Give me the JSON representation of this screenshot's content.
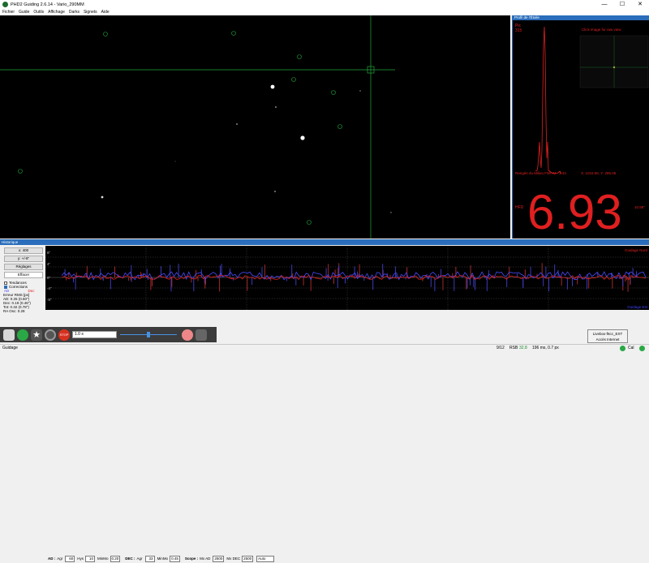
{
  "window": {
    "title": "PHD2 Guiding 2.6.14 - Vario_290MM",
    "minimize": "—",
    "maximize": "☐",
    "close": "✕"
  },
  "menu": [
    "Fichier",
    "Guide",
    "Outils",
    "Affichage",
    "Darks",
    "Signets",
    "Aide"
  ],
  "profile_panel": {
    "title": "Profil de l'Étoile",
    "pic_label": "Pic",
    "pic_value": "315",
    "click_hint": "Click image for raw view",
    "fwhm_text": "Rangée du Milieu FWHM : 1.43",
    "coords_text": "X: 1016.56, Y: 286.05",
    "hfd_label": "HFD",
    "hfd_value": "6.93",
    "hfd_arcsec": "10.88\"",
    "colors": {
      "profile": "#e02020",
      "value": "#e02020"
    }
  },
  "history": {
    "title": "Historique",
    "buttons": {
      "x_scale": "x: 400",
      "y_scale": "y: +/-8\"",
      "settings": "Réglages",
      "clear": "Effacer"
    },
    "legend": {
      "trends": "Tendances",
      "corrections": "Corrections",
      "ra": "AD",
      "dec": "Dec"
    },
    "rms": {
      "title": "Erreur RMS [px]",
      "ra": "AD: 0.25 (0.60\")",
      "dec": "Dec: 0.19 (0.46\")",
      "tot": "Tot: 0.32 (0.78\")",
      "ra_osc": "RA Osc: 0.28"
    },
    "graph_labels": {
      "top_right": "Guidage Nord",
      "bottom_right": "Guidage Est",
      "y_ticks": [
        "8\"",
        "4\"",
        "0\"",
        "-4\"",
        "-8\""
      ]
    },
    "controls": {
      "ra_label": "AD :",
      "ra_algo": "Agr",
      "ra_agr": "60",
      "hys_label": "Hys",
      "hys_value": "10",
      "minmo_label": "MinMo",
      "minmo_value": "0.20",
      "dec_label": "DEC :",
      "dec_algo": "Agr",
      "dec_agr": "33",
      "minmo2_label": "MinMo",
      "minmo2_value": "0.45",
      "scope_label": "Scope :",
      "mx_ra_label": "Mx AD",
      "mx_ra_value": "2500",
      "mx_dec_label": "Mx DEC",
      "mx_dec_value": "2500",
      "mode_value": "Auto"
    },
    "colors": {
      "ra": "#4040ff",
      "dec": "#e02020"
    }
  },
  "toolbar": {
    "exposure": "1.0 s"
  },
  "status": {
    "mode": "Guidage",
    "frame": "9/12",
    "rsb": "RSB",
    "snr": "32.8",
    "guide_info": "196 ms, 0.7 px",
    "cal": "Cal"
  },
  "tooltip": {
    "line1": "Livebox-f6cc_EXT",
    "line2": "Accès Internet"
  }
}
